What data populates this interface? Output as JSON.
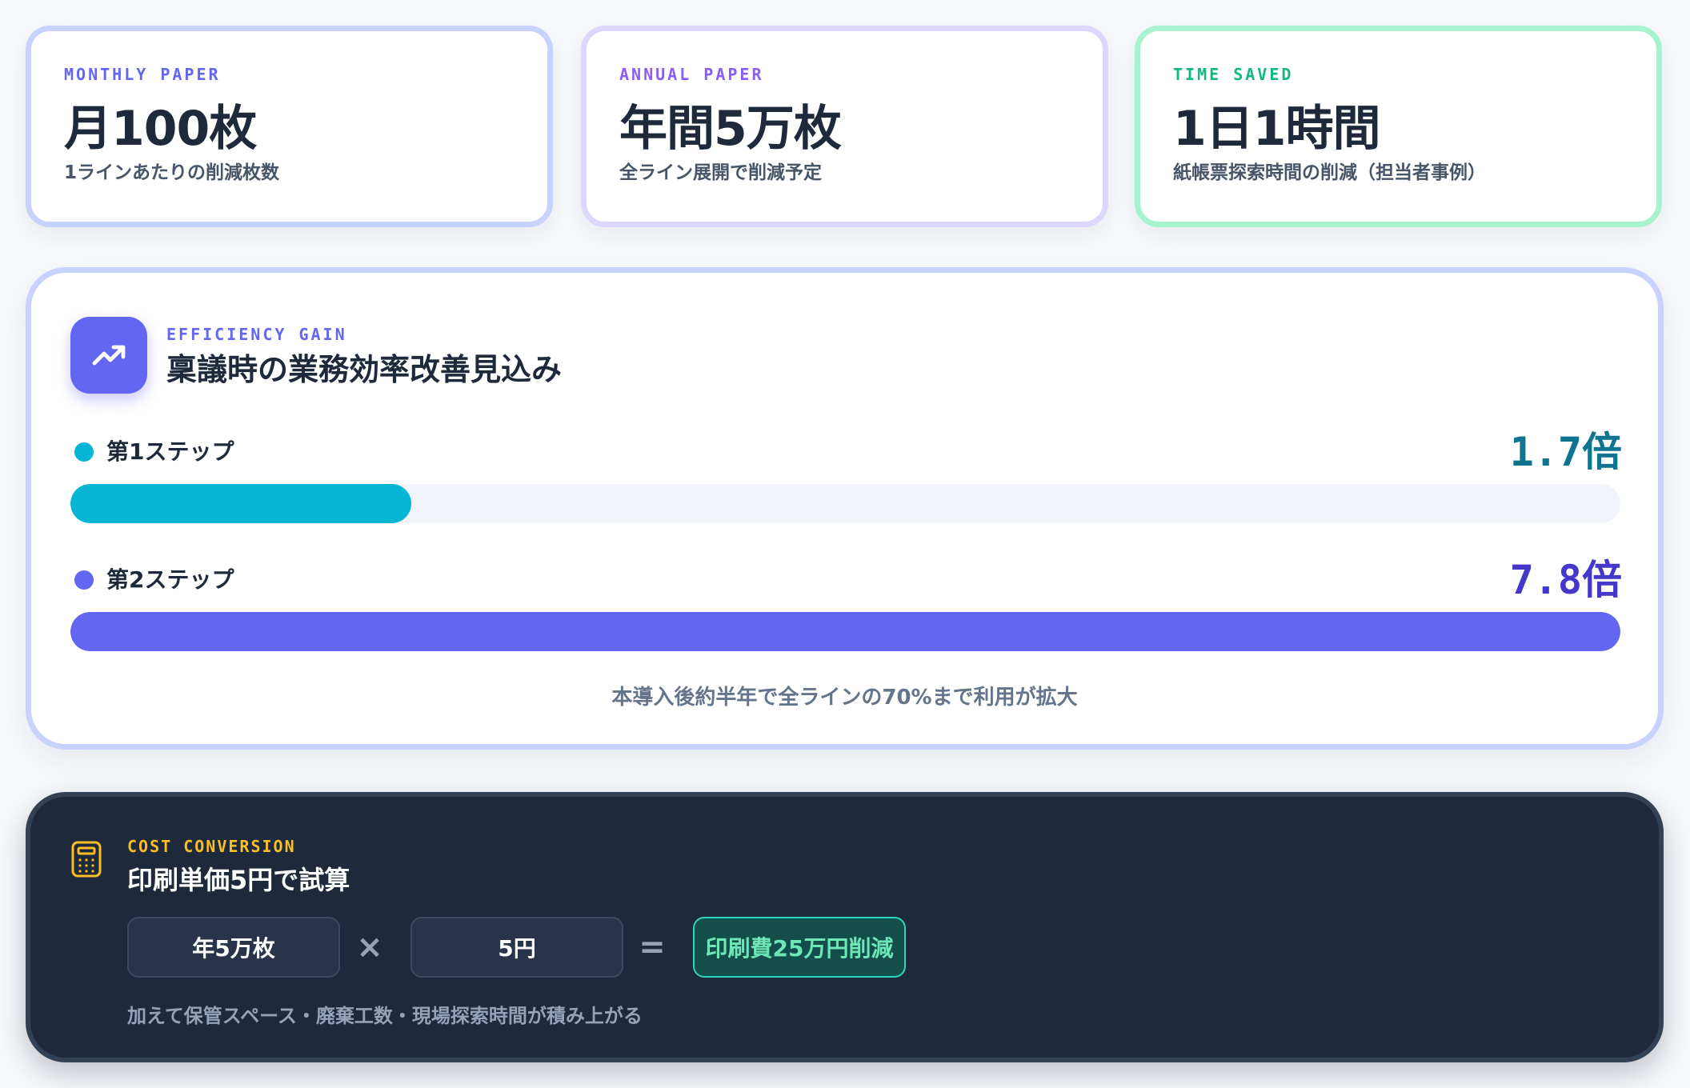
{
  "stats": [
    {
      "label": "MONTHLY PAPER",
      "value": "月100枚",
      "sub": "1ラインあたりの削減枚数"
    },
    {
      "label": "ANNUAL PAPER",
      "value": "年間5万枚",
      "sub": "全ライン展開で削減予定"
    },
    {
      "label": "TIME SAVED",
      "value": "1日1時間",
      "sub": "紙帳票探索時間の削減（担当者事例）"
    }
  ],
  "efficiency": {
    "icon": "trending-up-icon",
    "eyebrow": "EFFICIENCY GAIN",
    "title": "稟議時の業務効率改善見込み",
    "steps": [
      {
        "label": "第1ステップ",
        "value": "1.7倍",
        "fraction": 0.22,
        "color": "#06b6d4",
        "value_color": "#0e7490"
      },
      {
        "label": "第2ステップ",
        "value": "7.8倍",
        "fraction": 1.0,
        "color": "#6366f1",
        "value_color": "#4338ca"
      }
    ],
    "note": "本導入後約半年で全ラインの70%まで利用が拡大"
  },
  "cost": {
    "icon": "calculator-icon",
    "eyebrow": "COST CONVERSION",
    "title": "印刷単価5円で試算",
    "operand1": "年5万枚",
    "operator1": "×",
    "operand2": "5円",
    "operator2": "=",
    "result": "印刷費25万円削減",
    "note": "加えて保管スペース・廃棄工数・現場探索時間が積み上がる"
  }
}
